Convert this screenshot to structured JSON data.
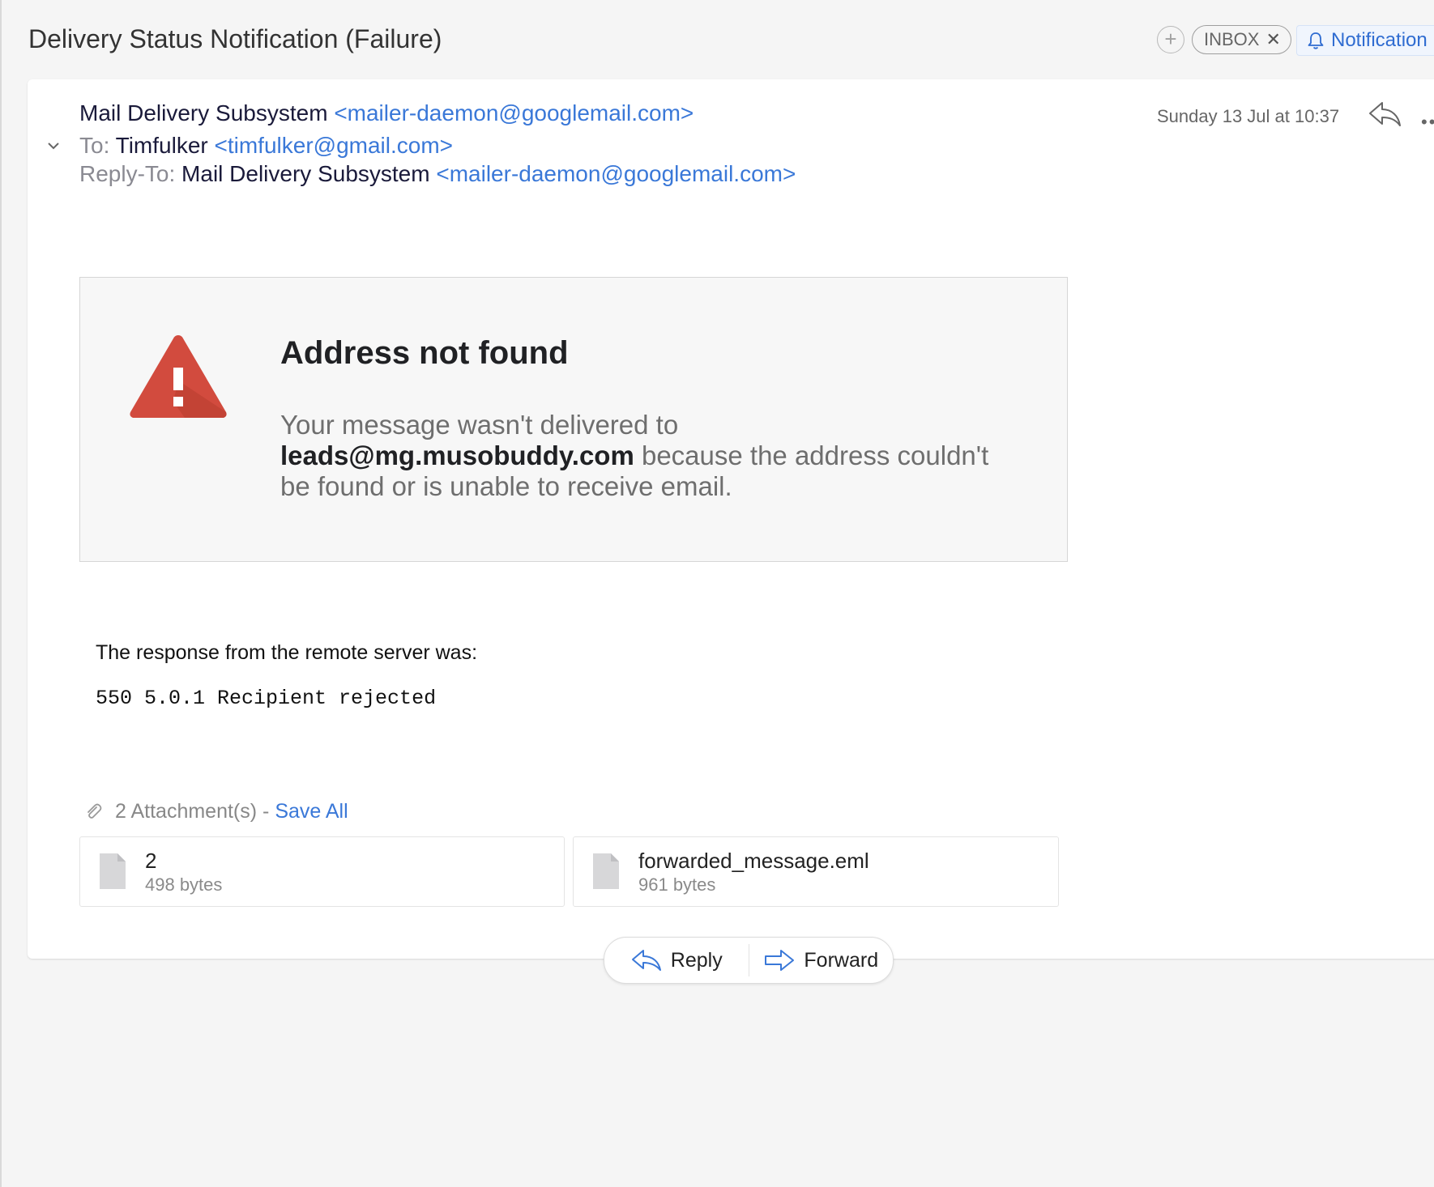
{
  "header": {
    "subject": "Delivery Status Notification (Failure)",
    "add_label_icon": "plus-icon",
    "inbox_label": "INBOX",
    "inbox_remove": "✕",
    "notification_label": "Notification",
    "notification_icon": "bell-icon"
  },
  "message": {
    "from_name": "Mail Delivery Subsystem",
    "from_email": "<mailer-daemon@googlemail.com>",
    "to_label": "To:",
    "to_name": "Timfulker",
    "to_email": "<timfulker@gmail.com>",
    "reply_to_label": "Reply-To:",
    "reply_to_name": "Mail Delivery Subsystem",
    "reply_to_email": "<mailer-daemon@googlemail.com>",
    "date": "Sunday 13 Jul at 10:37",
    "more": "••"
  },
  "error": {
    "title": "Address not found",
    "text_before": "Your message wasn't delivered to ",
    "address": "leads@mg.musobuddy.com",
    "text_after": " because the address couldn't be found or is unable to receive email.",
    "response_label": "The response from the remote server was:",
    "response_code": "550 5.0.1 Recipient rejected"
  },
  "attachments": {
    "summary": "2 Attachment(s) -",
    "save_all": "Save All",
    "items": [
      {
        "name": "2",
        "size": "498 bytes"
      },
      {
        "name": "forwarded_message.eml",
        "size": "961 bytes"
      }
    ]
  },
  "actions": {
    "reply": "Reply",
    "forward": "Forward"
  },
  "colors": {
    "accent": "#3a78d8",
    "warning_red": "#d24b3e"
  }
}
